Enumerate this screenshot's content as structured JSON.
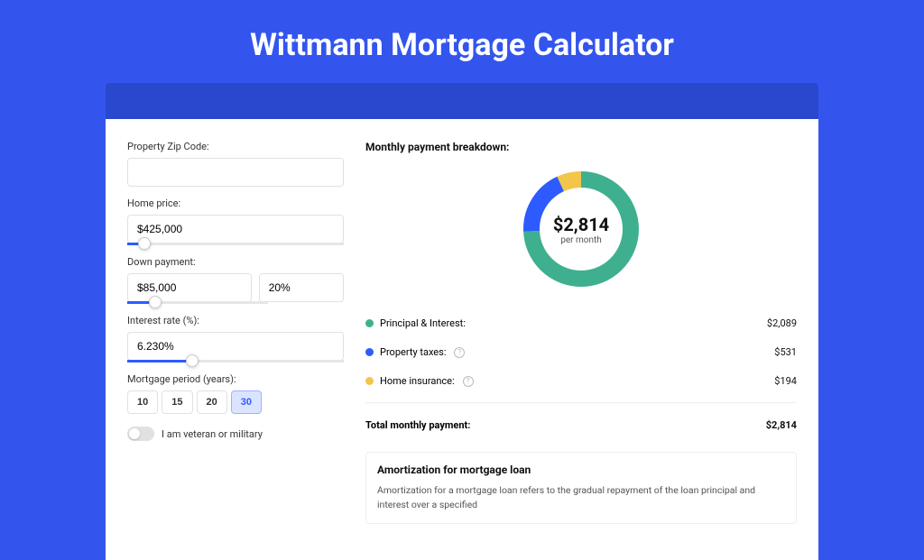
{
  "title": "Wittmann Mortgage Calculator",
  "form": {
    "zip": {
      "label": "Property Zip Code:",
      "value": ""
    },
    "homePrice": {
      "label": "Home price:",
      "value": "$425,000",
      "sliderPct": 8
    },
    "downPayment": {
      "label": "Down payment:",
      "amount": "$85,000",
      "pct": "20%",
      "sliderPct": 20
    },
    "interestRate": {
      "label": "Interest rate (%):",
      "value": "6.230%",
      "sliderPct": 30
    },
    "period": {
      "label": "Mortgage period (years):",
      "options": [
        "10",
        "15",
        "20",
        "30"
      ],
      "active": "30"
    },
    "veteran": {
      "label": "I am veteran or military",
      "on": false
    }
  },
  "breakdown": {
    "header": "Monthly payment breakdown:",
    "totalAmount": "$2,814",
    "perMonth": "per month",
    "items": [
      {
        "label": "Principal & Interest:",
        "value": "$2,089",
        "color": "#3fb08f",
        "num": 2089,
        "info": false
      },
      {
        "label": "Property taxes:",
        "value": "$531",
        "color": "#2e5bff",
        "num": 531,
        "info": true
      },
      {
        "label": "Home insurance:",
        "value": "$194",
        "color": "#f3c54b",
        "num": 194,
        "info": true
      }
    ],
    "totalLabel": "Total monthly payment:",
    "totalValue": "$2,814"
  },
  "amort": {
    "title": "Amortization for mortgage loan",
    "text": "Amortization for a mortgage loan refers to the gradual repayment of the loan principal and interest over a specified"
  },
  "chart_data": {
    "type": "pie",
    "title": "Monthly payment breakdown",
    "categories": [
      "Principal & Interest",
      "Property taxes",
      "Home insurance"
    ],
    "values": [
      2089,
      531,
      194
    ],
    "colors": [
      "#3fb08f",
      "#2e5bff",
      "#f3c54b"
    ],
    "total": 2814,
    "unit": "USD per month"
  }
}
